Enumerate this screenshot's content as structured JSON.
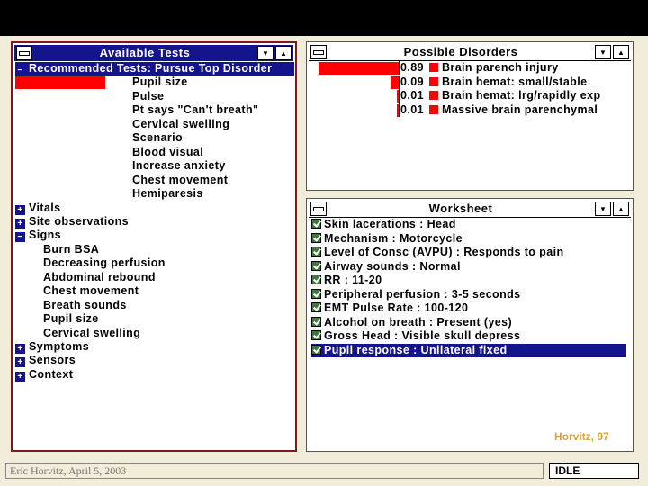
{
  "available_tests": {
    "title": "Available Tests",
    "recommended": "Recommended Tests: Pursue Top Disorder",
    "recommended_items": [
      "Pupil size",
      "Pulse",
      "Pt says \"Can't breath\"",
      "Cervical swelling",
      "Scenario",
      "Blood visual",
      "Increase anxiety",
      "Chest movement",
      "Hemiparesis"
    ],
    "groups": [
      {
        "label": "Vitals",
        "state": "+"
      },
      {
        "label": "Site observations",
        "state": "+"
      },
      {
        "label": "Signs",
        "state": "−"
      }
    ],
    "sign_items": [
      "Burn BSA",
      "Decreasing perfusion",
      "Abdominal rebound",
      "Chest movement",
      "Breath sounds",
      "Pupil size",
      "Cervical swelling"
    ],
    "groups_after": [
      {
        "label": "Symptoms",
        "state": "+"
      },
      {
        "label": "Sensors",
        "state": "+"
      },
      {
        "label": "Context",
        "state": "+"
      }
    ]
  },
  "possible_disorders": {
    "title": "Possible Disorders",
    "items": [
      {
        "prob": "0.89",
        "value": 0.89,
        "label": "Brain parench injury"
      },
      {
        "prob": "0.09",
        "value": 0.09,
        "label": "Brain hemat: small/stable"
      },
      {
        "prob": "0.01",
        "value": 0.01,
        "label": "Brain hemat: lrg/rapidly exp"
      },
      {
        "prob": "0.01",
        "value": 0.01,
        "label": "Massive brain parenchymal"
      }
    ]
  },
  "worksheet": {
    "title": "Worksheet",
    "items": [
      "Skin lacerations : Head",
      "Mechanism : Motorcycle",
      "Level of Consc (AVPU) : Responds to pain",
      "Airway sounds : Normal",
      "RR : 11-20",
      "Peripheral perfusion : 3-5 seconds",
      "EMT Pulse Rate : 100-120",
      "Alcohol on breath : Present (yes)",
      "Gross Head : Visible skull depress",
      "Pupil response : Unilateral fixed"
    ],
    "signature": "Horvitz, 97"
  },
  "footer": {
    "credit": "Eric Horvitz, April 5, 2003",
    "status": "IDLE"
  },
  "colors": {
    "highlight": "#14148c",
    "bar": "#ff0000",
    "check": "#3a7a3a",
    "signature": "#e0a030"
  }
}
